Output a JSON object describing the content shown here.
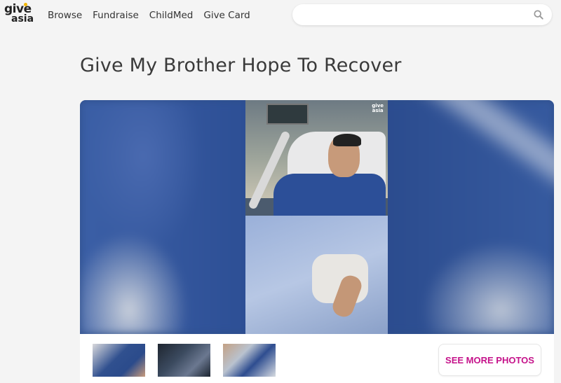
{
  "logo": {
    "line1": "give",
    "line2": "asia",
    "dot_colors": [
      "#f2b705",
      "#e6007e"
    ]
  },
  "nav": {
    "items": [
      {
        "label": "Browse"
      },
      {
        "label": "Fundraise"
      },
      {
        "label": "ChildMed"
      },
      {
        "label": "Give Card"
      }
    ]
  },
  "search": {
    "value": "",
    "placeholder": "",
    "icon": "search-icon"
  },
  "campaign": {
    "title": "Give My Brother Hope To Recover"
  },
  "hero": {
    "watermark_line1": "give",
    "watermark_line2": "asia"
  },
  "gallery": {
    "thumbnail_count": 3,
    "see_more_label": "SEE MORE PHOTOS"
  },
  "colors": {
    "accent": "#c5128a",
    "background": "#f4f4f4"
  }
}
